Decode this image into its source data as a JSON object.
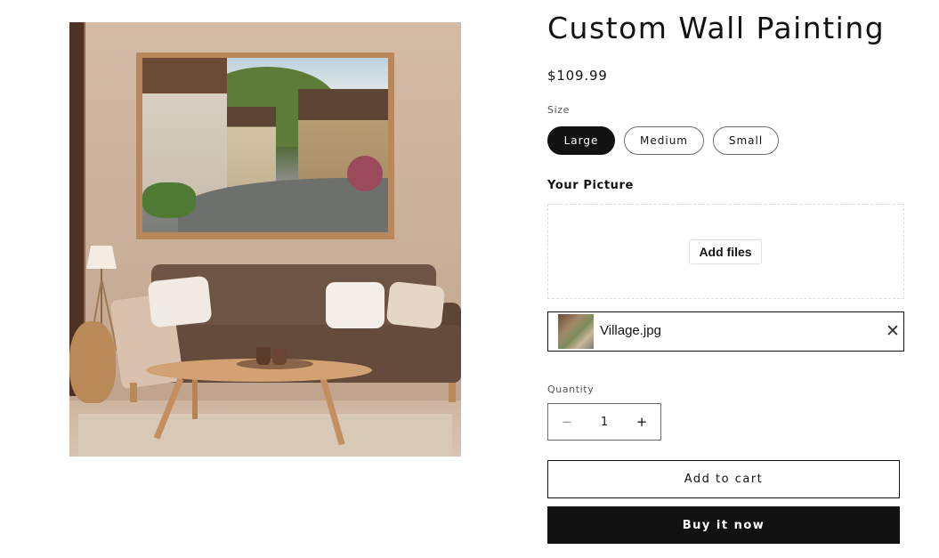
{
  "product": {
    "title": "Custom Wall Painting",
    "price": "$109.99",
    "image_alt": "Framed village street painting above a brown sofa"
  },
  "size": {
    "label": "Size",
    "options": [
      {
        "label": "Large",
        "selected": true
      },
      {
        "label": "Medium",
        "selected": false
      },
      {
        "label": "Small",
        "selected": false
      }
    ]
  },
  "upload": {
    "label": "Your Picture",
    "add_files": "Add files",
    "file_name": "Village.jpg",
    "remove_icon": "close-icon"
  },
  "quantity": {
    "label": "Quantity",
    "value": "1",
    "minus": "−",
    "plus": "+"
  },
  "actions": {
    "add_to_cart": "Add to cart",
    "buy_now": "Buy it now"
  },
  "colors": {
    "primary": "#121212",
    "background": "#ffffff"
  }
}
